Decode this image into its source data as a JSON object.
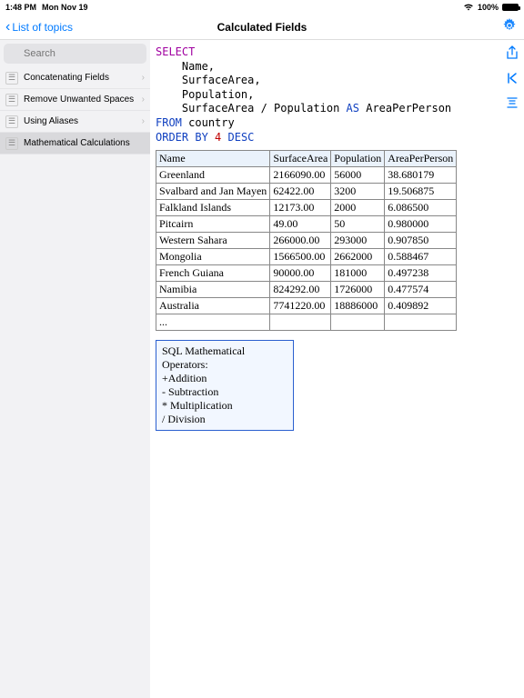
{
  "status": {
    "time": "1:48 PM",
    "date": "Mon Nov 19",
    "wifi": "􀙇",
    "battery_pct": "100%"
  },
  "nav": {
    "back": "List of topics",
    "title": "Calculated Fields"
  },
  "search": {
    "placeholder": "Search"
  },
  "topics": [
    {
      "label": "Concatenating Fields",
      "selected": false
    },
    {
      "label": "Remove Unwanted Spaces",
      "selected": false
    },
    {
      "label": "Using Aliases",
      "selected": false
    },
    {
      "label": "Mathematical Calculations",
      "selected": true
    }
  ],
  "sql": {
    "select": "SELECT",
    "cols": [
      "Name,",
      "SurfaceArea,",
      "Population,",
      "SurfaceArea / Population"
    ],
    "as": "AS",
    "alias": "AreaPerPerson",
    "from": "FROM",
    "table": "country",
    "order": "ORDER BY",
    "num": "4",
    "desc": "DESC"
  },
  "table": {
    "headers": [
      "Name",
      "SurfaceArea",
      "Population",
      "AreaPerPerson"
    ],
    "rows": [
      [
        "Greenland",
        "2166090.00",
        "56000",
        "38.680179"
      ],
      [
        "Svalbard and Jan Mayen",
        "62422.00",
        "3200",
        "19.506875"
      ],
      [
        "Falkland Islands",
        "12173.00",
        "2000",
        "6.086500"
      ],
      [
        "Pitcairn",
        "49.00",
        "50",
        "0.980000"
      ],
      [
        "Western Sahara",
        "266000.00",
        "293000",
        "0.907850"
      ],
      [
        "Mongolia",
        "1566500.00",
        "2662000",
        "0.588467"
      ],
      [
        "French Guiana",
        "90000.00",
        "181000",
        "0.497238"
      ],
      [
        "Namibia",
        "824292.00",
        "1726000",
        "0.477574"
      ],
      [
        "Australia",
        "7741220.00",
        "18886000",
        "0.409892"
      ],
      [
        "...",
        "",
        "",
        ""
      ]
    ]
  },
  "note": {
    "l1": "SQL Mathematical",
    "l2": "Operators:",
    "l3": "+Addition",
    "l4": "- Subtraction",
    "l5": "* Multiplication",
    "l6": "/ Division"
  }
}
